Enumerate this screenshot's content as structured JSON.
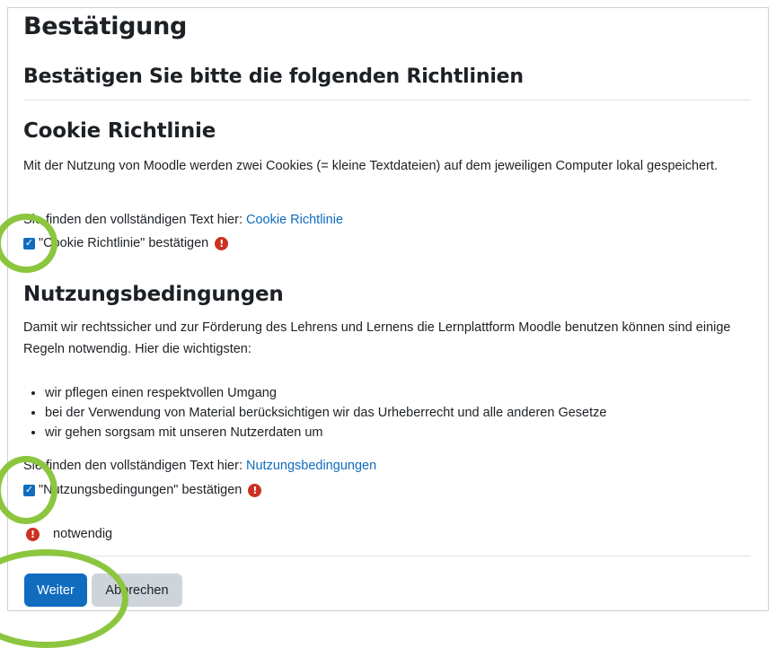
{
  "page": {
    "title": "Bestätigung",
    "subtitle": "Bestätigen Sie bitte die folgenden Richtlinien"
  },
  "policies": [
    {
      "title": "Cookie Richtlinie",
      "paragraph": "Mit der Nutzung von Moodle werden zwei Cookies (= kleine Textdateien) auf dem jeweiligen Computer lokal gespeichert.",
      "link_prefix": "Sie finden den vollständigen Text hier: ",
      "link_text": "Cookie Richtlinie",
      "checkbox_label": "\"Cookie Richtlinie\" bestätigen",
      "checked": true
    },
    {
      "title": "Nutzungsbedingungen",
      "paragraph": "Damit wir rechtssicher und zur Förderung des Lehrens und Lernens die Lernplattform Moodle benutzen können sind einige Regeln notwendig. Hier die wichtigsten:",
      "rules": [
        "wir pflegen einen respektvollen Umgang",
        "bei der Verwendung von Material berücksichtigen wir das Urheberrecht und alle anderen Gesetze",
        "wir gehen sorgsam mit unseren Nutzerdaten um"
      ],
      "link_prefix": "Sie finden den vollständigen Text hier: ",
      "link_text": "Nutzungsbedingungen",
      "checkbox_label": "\"Nutzungsbedingungen\" bestätigen",
      "checked": true
    }
  ],
  "required_note": "notwendig",
  "buttons": {
    "submit": "Weiter",
    "cancel": "Abbrechen"
  },
  "colors": {
    "primary": "#0f6cbf",
    "required": "#ca3120",
    "highlight": "#8cc63f"
  }
}
